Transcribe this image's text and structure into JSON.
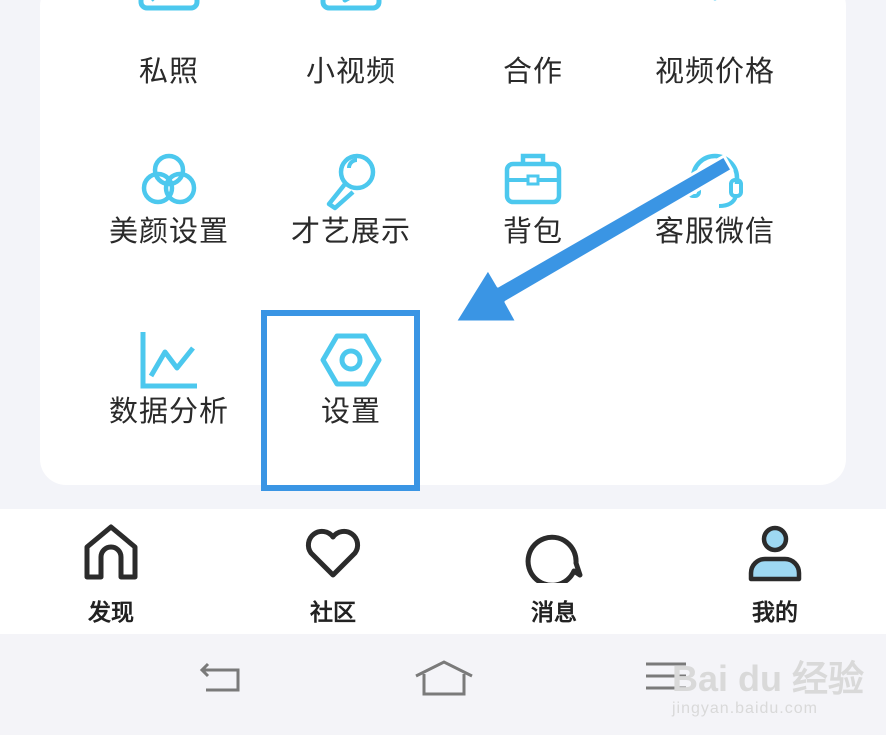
{
  "menu": {
    "row1": [
      "私照",
      "小视频",
      "合作",
      "视频价格"
    ],
    "row2": [
      "美颜设置",
      "才艺展示",
      "背包",
      "客服微信"
    ],
    "row3": [
      "数据分析",
      "设置"
    ]
  },
  "icons": {
    "private_photo": "image-icon",
    "short_video": "video-play-icon",
    "cooperation": "handshake-icon",
    "video_price": "price-tag-icon",
    "beauty": "beauty-circles-icon",
    "talent": "microphone-icon",
    "backpack": "briefcase-icon",
    "service": "headset-icon",
    "analytics": "line-chart-icon",
    "settings": "hexagon-nut-icon"
  },
  "tabs": [
    "发现",
    "社区",
    "消息",
    "我的"
  ],
  "watermark": {
    "logo": "Bai du 经验",
    "url": "jingyan.baidu.com"
  },
  "colors": {
    "icon": "#4cc8ee",
    "highlight": "#3a95e4",
    "active_tab": "#9ed8f2"
  }
}
